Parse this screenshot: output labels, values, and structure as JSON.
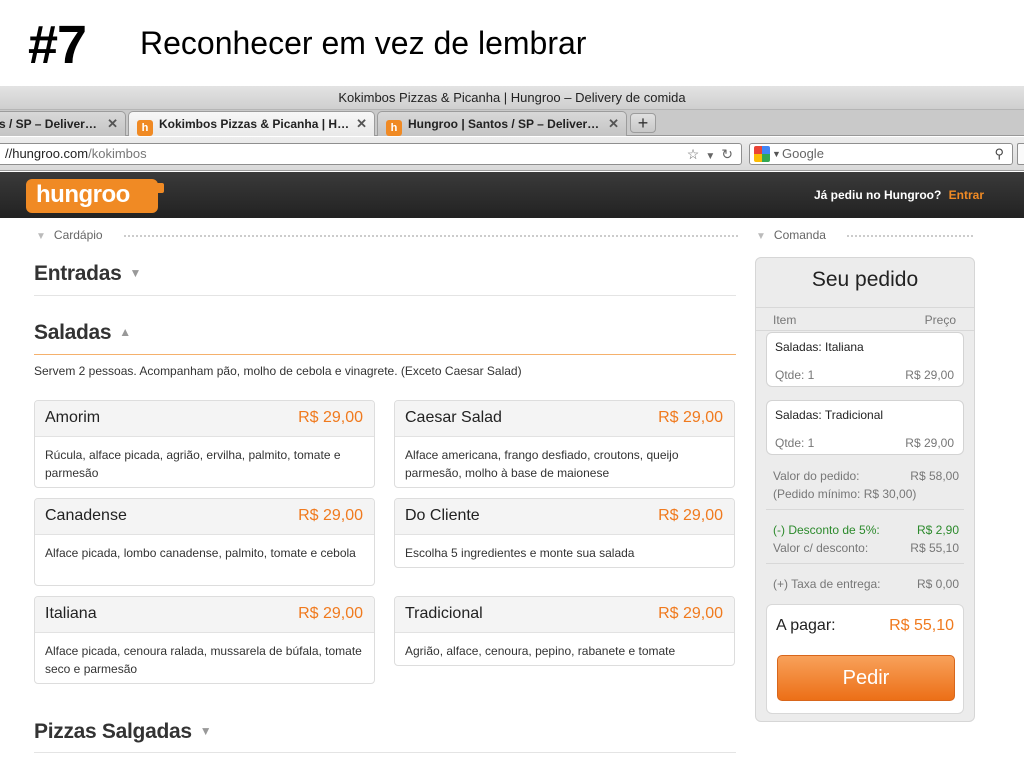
{
  "slide": {
    "number": "#7",
    "title": "Reconhecer em vez de lembrar"
  },
  "browser": {
    "window_title": "Kokimbos Pizzas & Picanha | Hungroo – Delivery de comida",
    "tabs": [
      {
        "label": "s / SP – Deliver…",
        "active": false
      },
      {
        "label": "Kokimbos Pizzas & Picanha | H…",
        "active": true
      },
      {
        "label": "Hungroo | Santos / SP – Deliver…",
        "active": false
      }
    ],
    "favicon_letter": "h",
    "tab_close": "✕",
    "new_tab": "+",
    "url_host": "//hungroo.com",
    "url_path": "/kokimbos",
    "search_placeholder": "Google",
    "icons": [
      "star-icon",
      "dropdown-icon",
      "reload-icon",
      "google-icon",
      "search-icon"
    ]
  },
  "site": {
    "logo_text": "hungroo",
    "login_prompt": "Já pediu no Hungroo?",
    "login_link": "Entrar",
    "accent_color": "#f07a1e"
  },
  "menu": {
    "section_label": "Cardápio",
    "categories": [
      {
        "title": "Entradas",
        "expanded": false
      },
      {
        "title": "Saladas",
        "expanded": true
      },
      {
        "title": "Pizzas Salgadas",
        "expanded": false
      }
    ],
    "saladas_description": "Servem 2 pessoas. Acompanham pão, molho de cebola e vinagrete. (Exceto Caesar Salad)",
    "items": [
      {
        "name": "Amorim",
        "price": "R$ 29,00",
        "desc": "Rúcula, alface picada, agrião, ervilha, palmito, tomate e parmesão"
      },
      {
        "name": "Caesar Salad",
        "price": "R$ 29,00",
        "desc": "Alface americana, frango desfiado, croutons, queijo parmesão, molho à base de maionese"
      },
      {
        "name": "Canadense",
        "price": "R$ 29,00",
        "desc": "Alface picada, lombo canadense, palmito, tomate e cebola"
      },
      {
        "name": "Do Cliente",
        "price": "R$ 29,00",
        "desc": "Escolha 5 ingredientes e monte sua salada"
      },
      {
        "name": "Italiana",
        "price": "R$ 29,00",
        "desc": "Alface picada, cenoura ralada, mussarela de búfala, tomate seco e parmesão"
      },
      {
        "name": "Tradicional",
        "price": "R$ 29,00",
        "desc": "Agrião, alface, cenoura, pepino, rabanete e tomate"
      }
    ]
  },
  "order": {
    "section_label": "Comanda",
    "title": "Seu pedido",
    "col_item": "Item",
    "col_price": "Preço",
    "items": [
      {
        "name": "Saladas: Italiana",
        "qty": "Qtde: 1",
        "price": "R$ 29,00"
      },
      {
        "name": "Saladas: Tradicional",
        "qty": "Qtde: 1",
        "price": "R$ 29,00"
      }
    ],
    "subtotal_label": "Valor do pedido:",
    "subtotal_value": "R$ 58,00",
    "minimum": "(Pedido mínimo: R$ 30,00)",
    "discount_label": "(-) Desconto de 5%:",
    "discount_value": "R$ 2,90",
    "discounted_label": "Valor c/ desconto:",
    "discounted_value": "R$ 55,10",
    "delivery_label": "(+) Taxa de entrega:",
    "delivery_value": "R$ 0,00",
    "total_label": "A pagar:",
    "total_value": "R$ 55,10",
    "submit_label": "Pedir",
    "discount_color": "#2c8a2c"
  }
}
